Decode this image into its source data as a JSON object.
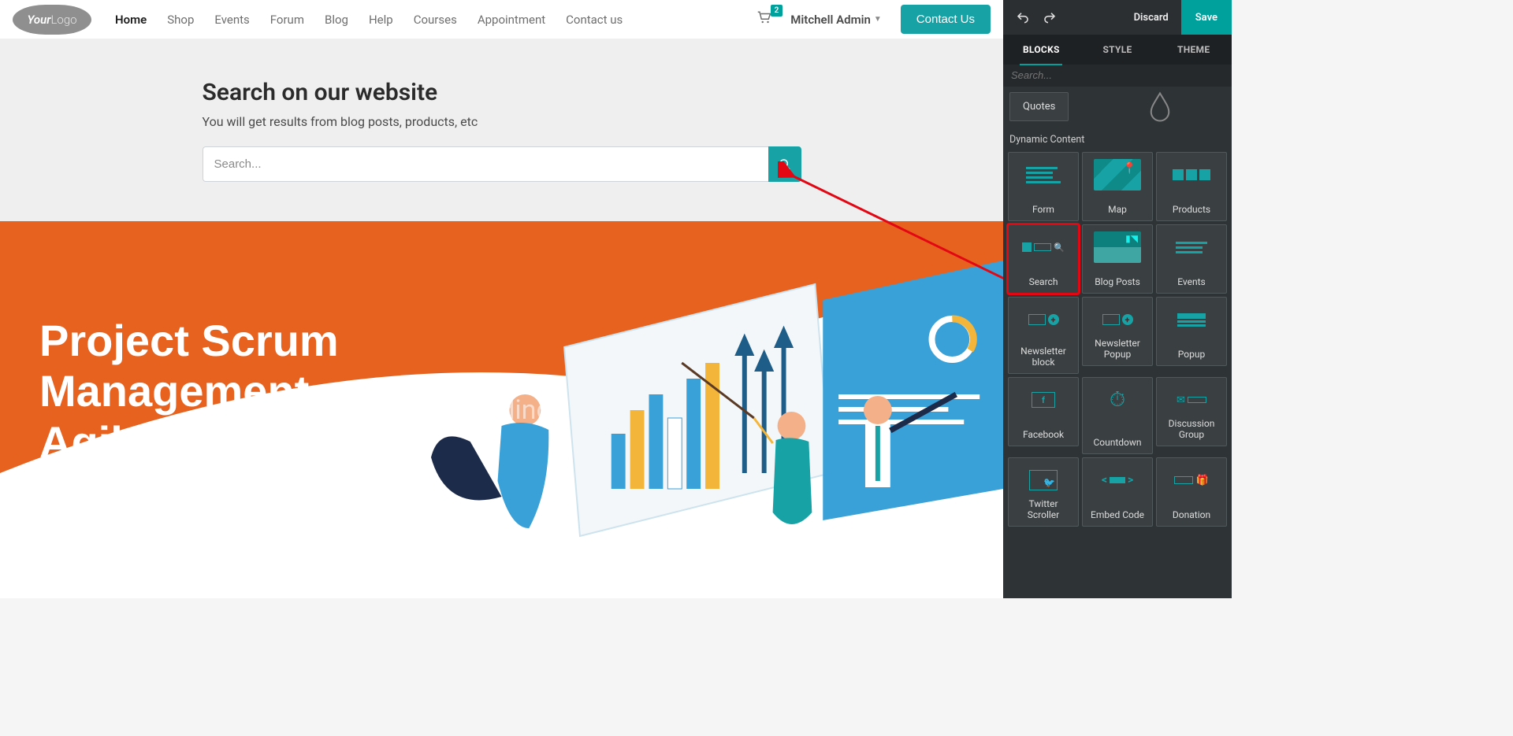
{
  "nav": {
    "logo_main": "Your",
    "logo_sub": "Logo",
    "items": [
      "Home",
      "Shop",
      "Events",
      "Forum",
      "Blog",
      "Help",
      "Courses",
      "Appointment",
      "Contact us"
    ],
    "active_index": 0,
    "cart_count": "2",
    "user_name": "Mitchell Admin",
    "contact_label": "Contact Us"
  },
  "search_hero": {
    "title": "Search on our website",
    "subtitle": "You will get results from blog posts, products, etc",
    "placeholder": "Search..."
  },
  "banner": {
    "heading": "Project Scrum\nManagement\nAgile",
    "ghost": "Heading"
  },
  "editor": {
    "discard": "Discard",
    "save": "Save",
    "tabs": [
      "BLOCKS",
      "STYLE",
      "THEME"
    ],
    "active_tab": 0,
    "search_placeholder": "Search...",
    "chip": "Quotes",
    "group_label": "Dynamic Content",
    "blocks": [
      {
        "label": "Form"
      },
      {
        "label": "Map"
      },
      {
        "label": "Products"
      },
      {
        "label": "Search"
      },
      {
        "label": "Blog Posts"
      },
      {
        "label": "Events"
      },
      {
        "label": "Newsletter block"
      },
      {
        "label": "Newsletter Popup"
      },
      {
        "label": "Popup"
      },
      {
        "label": "Facebook"
      },
      {
        "label": "Countdown"
      },
      {
        "label": "Discussion Group"
      },
      {
        "label": "Twitter Scroller"
      },
      {
        "label": "Embed Code"
      },
      {
        "label": "Donation"
      }
    ],
    "highlight_index": 3
  }
}
